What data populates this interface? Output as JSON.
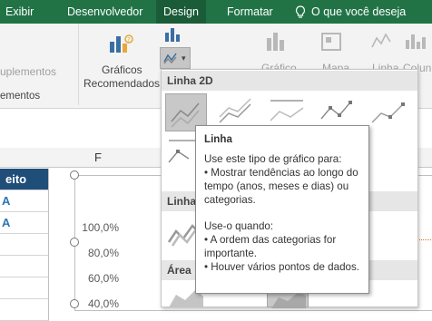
{
  "tabs": {
    "exibir": "Exibir",
    "desenvolvedor": "Desenvolvedor",
    "design": "Design",
    "formatar": "Formatar",
    "tell_me": "O que você deseja fazer"
  },
  "ribbon": {
    "suplementos_label": "uplementos",
    "suplementos_group": "ementos",
    "recommended_line1": "Gráficos",
    "recommended_line2": "Recomendados",
    "grafico_label": "Gráfico",
    "mapa_label": "Mapa",
    "linha_label": "Linha",
    "coluna_label": "Colun"
  },
  "sheet": {
    "column_f": "F",
    "cell_header": "eito",
    "cell_values": [
      "A",
      "A",
      "",
      "",
      "",
      ""
    ]
  },
  "chart": {
    "y_ticks": [
      "100,0%",
      "80,0%",
      "60,0%",
      "40,0%"
    ]
  },
  "gallery": {
    "section_2d": "Linha 2D",
    "section_3d": "Linha",
    "section_area": "Área"
  },
  "tooltip": {
    "title": "Linha",
    "intro": "Use este tipo de gráfico para:",
    "bullet1": "• Mostrar tendências ao longo do tempo (anos, meses e dias) ou categorias.",
    "when": "Use-o quando:",
    "bullet2": "• A ordem das categorias for importante.",
    "bullet3": "• Houver vários pontos de dados."
  },
  "colors": {
    "ribbon_green": "#217346",
    "header_blue": "#1f4e79",
    "cell_text_blue": "#2e75b6"
  }
}
